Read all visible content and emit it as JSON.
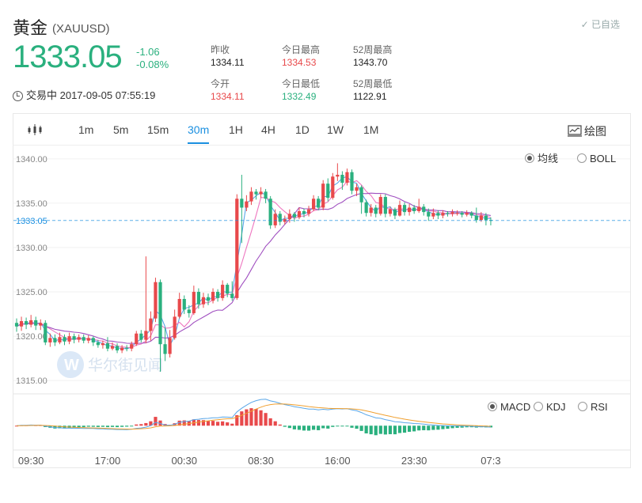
{
  "header": {
    "name": "黄金",
    "symbol": "(XAUUSD)",
    "favorite_label": "已自选",
    "price": "1333.05",
    "change": "-1.06",
    "change_pct": "-0.08%",
    "status": "交易中 2017-09-05 07:55:19",
    "stats": {
      "prev_close_label": "昨收",
      "prev_close": "1334.11",
      "open_label": "今开",
      "open": "1334.11",
      "high_label": "今日最高",
      "high": "1334.53",
      "low_label": "今日最低",
      "low": "1332.49",
      "w52_high_label": "52周最高",
      "w52_high": "1343.70",
      "w52_low_label": "52周最低",
      "w52_low": "1122.91"
    }
  },
  "toolbar": {
    "tabs": [
      "1m",
      "5m",
      "15m",
      "30m",
      "1H",
      "4H",
      "1D",
      "1W",
      "1M"
    ],
    "active": "30m",
    "draw_label": "绘图"
  },
  "indicators": {
    "main": [
      {
        "label": "均线",
        "selected": true
      },
      {
        "label": "BOLL",
        "selected": false
      }
    ],
    "sub": [
      {
        "label": "MACD",
        "selected": true
      },
      {
        "label": "KDJ",
        "selected": false
      },
      {
        "label": "RSI",
        "selected": false
      }
    ]
  },
  "watermark": "华尔街见闻",
  "colors": {
    "up": "#e8494b",
    "down": "#2ab07e",
    "accent": "#1a8fe0",
    "ma_fast": "#5aa7e8",
    "ma_mid": "#ee77c0",
    "ma_slow": "#a04fc0",
    "dea": "#f0a030"
  },
  "chart_data": {
    "type": "candlestick",
    "ylim": [
      1313.5,
      1341.5
    ],
    "yticks": [
      "1340.00",
      "1335.00",
      "1330.00",
      "1325.00",
      "1320.00",
      "1315.00"
    ],
    "current_price_label": "1333.05",
    "current_price": 1333.05,
    "xticks": [
      {
        "label": "09:30",
        "index": 3
      },
      {
        "label": "17:00",
        "index": 19
      },
      {
        "label": "00:30",
        "index": 35
      },
      {
        "label": "08:30",
        "index": 51
      },
      {
        "label": "16:00",
        "index": 67
      },
      {
        "label": "23:30",
        "index": 83
      },
      {
        "label": "07:3",
        "index": 99
      }
    ],
    "candles": [
      [
        1321.5,
        1321.1,
        1322.0,
        1320.5
      ],
      [
        1321.1,
        1321.7,
        1322.2,
        1320.6
      ],
      [
        1321.7,
        1321.3,
        1322.1,
        1320.8
      ],
      [
        1321.3,
        1321.8,
        1322.4,
        1321.0
      ],
      [
        1321.8,
        1321.2,
        1322.2,
        1320.7
      ],
      [
        1321.2,
        1321.5,
        1321.9,
        1320.7
      ],
      [
        1321.5,
        1319.3,
        1321.8,
        1319.0
      ],
      [
        1319.3,
        1319.8,
        1320.3,
        1318.8
      ],
      [
        1319.8,
        1319.3,
        1320.2,
        1318.9
      ],
      [
        1319.3,
        1319.9,
        1320.4,
        1319.1
      ],
      [
        1319.9,
        1319.4,
        1320.2,
        1319.0
      ],
      [
        1319.4,
        1320.0,
        1320.4,
        1319.1
      ],
      [
        1320.0,
        1319.6,
        1320.3,
        1319.2
      ],
      [
        1319.6,
        1319.9,
        1320.2,
        1319.3
      ],
      [
        1319.9,
        1319.5,
        1320.2,
        1319.2
      ],
      [
        1319.5,
        1319.8,
        1320.1,
        1319.2
      ],
      [
        1319.8,
        1319.3,
        1320.0,
        1318.9
      ],
      [
        1319.3,
        1319.0,
        1319.6,
        1318.7
      ],
      [
        1319.0,
        1319.2,
        1319.5,
        1318.6
      ],
      [
        1319.2,
        1318.6,
        1319.9,
        1318.3
      ],
      [
        1318.6,
        1318.9,
        1319.3,
        1318.4
      ],
      [
        1318.9,
        1318.4,
        1319.2,
        1318.1
      ],
      [
        1318.4,
        1318.7,
        1319.0,
        1318.1
      ],
      [
        1318.7,
        1318.6,
        1319.0,
        1318.3
      ],
      [
        1318.6,
        1319.1,
        1319.4,
        1318.3
      ],
      [
        1319.1,
        1320.3,
        1320.6,
        1318.9
      ],
      [
        1320.3,
        1319.6,
        1320.7,
        1319.3
      ],
      [
        1319.6,
        1320.6,
        1329.0,
        1319.2
      ],
      [
        1320.6,
        1322.0,
        1322.8,
        1319.5
      ],
      [
        1322.0,
        1326.1,
        1326.6,
        1321.6
      ],
      [
        1326.1,
        1319.1,
        1326.4,
        1316.0
      ],
      [
        1319.1,
        1318.0,
        1321.0,
        1317.2
      ],
      [
        1318.0,
        1319.8,
        1320.7,
        1317.6
      ],
      [
        1319.8,
        1322.2,
        1323.0,
        1319.6
      ],
      [
        1322.2,
        1324.2,
        1324.9,
        1322.0
      ],
      [
        1324.2,
        1323.0,
        1324.6,
        1322.5
      ],
      [
        1323.0,
        1322.6,
        1323.5,
        1322.1
      ],
      [
        1322.6,
        1325.0,
        1325.7,
        1322.4
      ],
      [
        1325.0,
        1323.6,
        1325.4,
        1323.1
      ],
      [
        1323.6,
        1324.4,
        1324.9,
        1323.2
      ],
      [
        1324.4,
        1324.0,
        1324.8,
        1323.5
      ],
      [
        1324.0,
        1325.0,
        1325.4,
        1323.7
      ],
      [
        1325.0,
        1324.3,
        1325.3,
        1323.9
      ],
      [
        1324.3,
        1325.8,
        1326.3,
        1324.0
      ],
      [
        1325.8,
        1324.8,
        1326.0,
        1324.4
      ],
      [
        1324.8,
        1324.3,
        1326.2,
        1324.0
      ],
      [
        1324.3,
        1335.5,
        1336.0,
        1324.1
      ],
      [
        1335.5,
        1334.5,
        1338.2,
        1330.5
      ],
      [
        1334.5,
        1335.2,
        1335.9,
        1334.1
      ],
      [
        1335.2,
        1336.3,
        1336.8,
        1334.8
      ],
      [
        1336.3,
        1336.0,
        1336.6,
        1335.4
      ],
      [
        1336.0,
        1336.3,
        1336.8,
        1335.6
      ],
      [
        1336.3,
        1335.5,
        1336.6,
        1335.0
      ],
      [
        1335.5,
        1332.5,
        1335.8,
        1332.1
      ],
      [
        1332.5,
        1333.8,
        1334.3,
        1332.2
      ],
      [
        1333.8,
        1332.9,
        1334.1,
        1332.5
      ],
      [
        1332.9,
        1333.2,
        1333.6,
        1332.6
      ],
      [
        1333.2,
        1333.8,
        1334.3,
        1332.8
      ],
      [
        1333.8,
        1333.4,
        1334.0,
        1332.9
      ],
      [
        1333.4,
        1334.1,
        1334.5,
        1333.2
      ],
      [
        1334.1,
        1333.8,
        1334.4,
        1333.4
      ],
      [
        1333.8,
        1334.3,
        1334.7,
        1333.5
      ],
      [
        1334.3,
        1335.5,
        1335.9,
        1334.1
      ],
      [
        1335.5,
        1334.5,
        1335.8,
        1334.2
      ],
      [
        1334.5,
        1337.2,
        1337.6,
        1334.2
      ],
      [
        1337.2,
        1335.6,
        1337.8,
        1335.2
      ],
      [
        1335.6,
        1338.0,
        1338.4,
        1335.4
      ],
      [
        1338.0,
        1338.2,
        1339.5,
        1337.5
      ],
      [
        1338.2,
        1337.3,
        1338.6,
        1336.5
      ],
      [
        1337.3,
        1338.5,
        1338.9,
        1337.0
      ],
      [
        1338.5,
        1336.4,
        1338.8,
        1336.0
      ],
      [
        1336.4,
        1336.8,
        1337.2,
        1335.8
      ],
      [
        1336.8,
        1335.1,
        1337.0,
        1333.8
      ],
      [
        1335.1,
        1333.9,
        1335.4,
        1333.5
      ],
      [
        1333.9,
        1334.5,
        1334.9,
        1333.5
      ],
      [
        1334.5,
        1333.8,
        1334.8,
        1333.4
      ],
      [
        1333.8,
        1335.7,
        1336.0,
        1333.6
      ],
      [
        1335.7,
        1333.8,
        1336.0,
        1333.4
      ],
      [
        1333.8,
        1334.3,
        1334.6,
        1333.5
      ],
      [
        1334.3,
        1333.6,
        1334.5,
        1333.2
      ],
      [
        1333.6,
        1334.8,
        1335.3,
        1333.5
      ],
      [
        1334.8,
        1334.0,
        1335.1,
        1333.6
      ],
      [
        1334.0,
        1334.5,
        1334.9,
        1333.6
      ],
      [
        1334.5,
        1334.1,
        1334.8,
        1333.8
      ],
      [
        1334.1,
        1334.6,
        1335.5,
        1333.9
      ],
      [
        1334.6,
        1334.0,
        1334.9,
        1333.6
      ],
      [
        1334.0,
        1333.5,
        1334.4,
        1333.0
      ],
      [
        1333.5,
        1333.9,
        1334.4,
        1333.2
      ],
      [
        1333.9,
        1333.6,
        1334.2,
        1333.2
      ],
      [
        1333.6,
        1333.9,
        1334.2,
        1333.3
      ],
      [
        1333.9,
        1333.8,
        1334.1,
        1333.5
      ],
      [
        1333.8,
        1334.0,
        1334.3,
        1333.5
      ],
      [
        1333.8,
        1333.9,
        1334.2,
        1333.6
      ],
      [
        1333.9,
        1333.7,
        1334.1,
        1333.4
      ],
      [
        1333.7,
        1333.9,
        1334.2,
        1333.5
      ],
      [
        1333.9,
        1333.6,
        1334.1,
        1333.3
      ],
      [
        1333.6,
        1333.1,
        1334.5,
        1332.8
      ],
      [
        1333.1,
        1333.6,
        1334.0,
        1332.9
      ],
      [
        1333.6,
        1333.1,
        1333.9,
        1332.5
      ],
      [
        1333.1,
        1333.05,
        1333.4,
        1332.5
      ]
    ],
    "macd_ylim": [
      -3.5,
      4.5
    ]
  }
}
